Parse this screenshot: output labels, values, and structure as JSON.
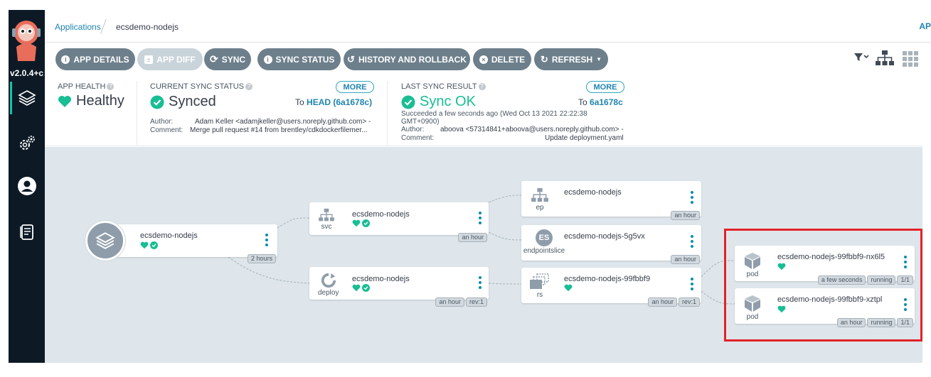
{
  "sidebar": {
    "version": "v2.0.4+c",
    "items": [
      {
        "icon": "layers-icon",
        "active": true
      },
      {
        "icon": "gears-icon",
        "active": false
      },
      {
        "icon": "user-icon",
        "active": false
      },
      {
        "icon": "docs-icon",
        "active": false
      }
    ]
  },
  "breadcrumb": {
    "root": "Applications",
    "current": "ecsdemo-nodejs",
    "right_label": "AP"
  },
  "toolbar": {
    "app_details": "APP DETAILS",
    "app_diff": "APP DIFF",
    "sync": "SYNC",
    "sync_status": "SYNC STATUS",
    "history": "HISTORY AND ROLLBACK",
    "delete": "DELETE",
    "refresh": "REFRESH"
  },
  "status": {
    "health": {
      "title": "APP HEALTH",
      "value": "Healthy",
      "color": "#18be94"
    },
    "current_sync": {
      "title": "CURRENT SYNC STATUS",
      "value": "Synced",
      "more": "MORE",
      "to_prefix": "To",
      "revision": "HEAD (6a1678c)",
      "author_label": "Author:",
      "author": "Adam Keller <adamjkeller@users.noreply.github.com> -",
      "comment_label": "Comment:",
      "comment": "Merge pull request #14 from brentley/cdkdockerfilemer..."
    },
    "last_sync": {
      "title": "LAST SYNC RESULT",
      "value": "Sync OK",
      "more": "MORE",
      "to_prefix": "To",
      "revision": "6a1678c",
      "time_line1": "Succeeded a few seconds ago (Wed Oct 13 2021 22:22:38",
      "time_line2": "GMT+0900)",
      "author_label": "Author:",
      "author": "aboova <57314841+aboova@users.noreply.github.com> -",
      "comment_label": "Comment:",
      "comment": "Update deployment.yaml"
    }
  },
  "tree": {
    "app": {
      "name": "ecsdemo-nodejs",
      "tags": [
        "2 hours"
      ]
    },
    "svc": {
      "name": "ecsdemo-nodejs",
      "kind": "svc",
      "tags": [
        "an hour"
      ]
    },
    "deploy": {
      "name": "ecsdemo-nodejs",
      "kind": "deploy",
      "tags": [
        "an hour",
        "rev:1"
      ]
    },
    "ep": {
      "name": "ecsdemo-nodejs",
      "kind": "ep",
      "tags": [
        "an hour"
      ]
    },
    "endpointslice": {
      "name": "ecsdemo-nodejs-5g5vx",
      "kind": "endpointslice",
      "badge": "ES",
      "tags": [
        "an hour"
      ]
    },
    "rs": {
      "name": "ecsdemo-nodejs-99fbbf9",
      "kind": "rs",
      "tags": [
        "an hour",
        "rev:1"
      ]
    },
    "pod1": {
      "name": "ecsdemo-nodejs-99fbbf9-nx6l5",
      "kind": "pod",
      "tags": [
        "a few seconds",
        "running",
        "1/1"
      ]
    },
    "pod2": {
      "name": "ecsdemo-nodejs-99fbbf9-xztpl",
      "kind": "pod",
      "tags": [
        "an hour",
        "running",
        "1/1"
      ]
    }
  },
  "colors": {
    "healthy": "#18be94",
    "sidebar_bg": "#0d1a26",
    "button": "#6d7f8b",
    "highlight": "#e3222a",
    "canvas": "#dee6eb"
  }
}
